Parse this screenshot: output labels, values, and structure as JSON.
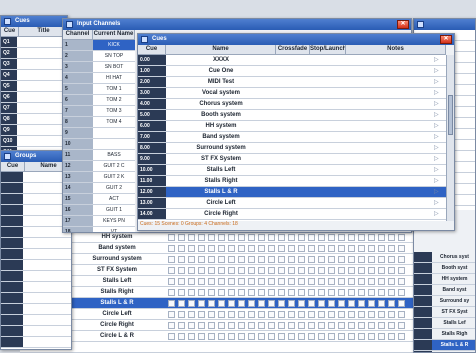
{
  "back_grid": {
    "names": [
      "HH system",
      "Band system",
      "Surround system",
      "ST FX System",
      "Stalls Left",
      "Stalls Right",
      "Stalls L & R",
      "Circle Left",
      "Circle Right",
      "Circle L & R"
    ],
    "selected_index": 6
  },
  "small_window": {
    "title": "Cues",
    "headers": [
      "Cue",
      "Title"
    ],
    "rows": [
      "Q1",
      "Q2",
      "Q3",
      "Q4",
      "Q5",
      "Q6",
      "Q7",
      "Q8",
      "Q9",
      "Q10",
      "Q11"
    ]
  },
  "groups_window": {
    "title": "Groups",
    "headers": [
      "Cue",
      "Name"
    ]
  },
  "input_window": {
    "title": "Input Channels",
    "headers": [
      "Channel",
      "Current Name"
    ],
    "rows": [
      {
        "ch": "1",
        "name": "KICK"
      },
      {
        "ch": "2",
        "name": "SN TOP"
      },
      {
        "ch": "3",
        "name": "SN BOT"
      },
      {
        "ch": "4",
        "name": "HI HAT"
      },
      {
        "ch": "5",
        "name": "TOM 1"
      },
      {
        "ch": "6",
        "name": "TOM 2"
      },
      {
        "ch": "7",
        "name": "TOM 3"
      },
      {
        "ch": "8",
        "name": "TOM 4"
      },
      {
        "ch": "9",
        "name": ""
      },
      {
        "ch": "10",
        "name": ""
      },
      {
        "ch": "11",
        "name": "BASS"
      },
      {
        "ch": "12",
        "name": "GUIT 2 C"
      },
      {
        "ch": "13",
        "name": "GUIT 2 K"
      },
      {
        "ch": "14",
        "name": "GUIT 2"
      },
      {
        "ch": "15",
        "name": "ACT"
      },
      {
        "ch": "16",
        "name": "GUIT 1"
      },
      {
        "ch": "17",
        "name": "KEYS PN"
      },
      {
        "ch": "18",
        "name": "VT"
      }
    ]
  },
  "cues_window": {
    "title": "Cues",
    "headers": [
      "Cue",
      "Name",
      "Crossfade",
      "Stop/Launch",
      "Notes"
    ],
    "rows": [
      {
        "cue": "0.00",
        "name": "XXXX"
      },
      {
        "cue": "1.00",
        "name": "Cue One"
      },
      {
        "cue": "2.00",
        "name": "MIDI Test"
      },
      {
        "cue": "3.00",
        "name": "Vocal system"
      },
      {
        "cue": "4.00",
        "name": "Chorus system"
      },
      {
        "cue": "5.00",
        "name": "Booth system"
      },
      {
        "cue": "6.00",
        "name": "HH system"
      },
      {
        "cue": "7.00",
        "name": "Band system"
      },
      {
        "cue": "8.00",
        "name": "Surround system"
      },
      {
        "cue": "9.00",
        "name": "ST FX System"
      },
      {
        "cue": "10.00",
        "name": "Stalls Left"
      },
      {
        "cue": "11.00",
        "name": "Stalls Right"
      },
      {
        "cue": "12.00",
        "name": "Stalls L & R"
      },
      {
        "cue": "13.00",
        "name": "Circle Left"
      },
      {
        "cue": "14.00",
        "name": "Circle Right"
      }
    ],
    "selected_index": 12,
    "footer": "Cues: 15   Scenes: 0   Groups: 4   Channels: 18"
  },
  "right_list": {
    "names": [
      "Chorus syst",
      "Booth syst",
      "HH system",
      "Band syst",
      "Surround sy",
      "ST FX Syst",
      "Stalls Lef",
      "Stalls Righ",
      "Stalls L & R",
      "Circle Lef"
    ],
    "selected_index": 8
  }
}
